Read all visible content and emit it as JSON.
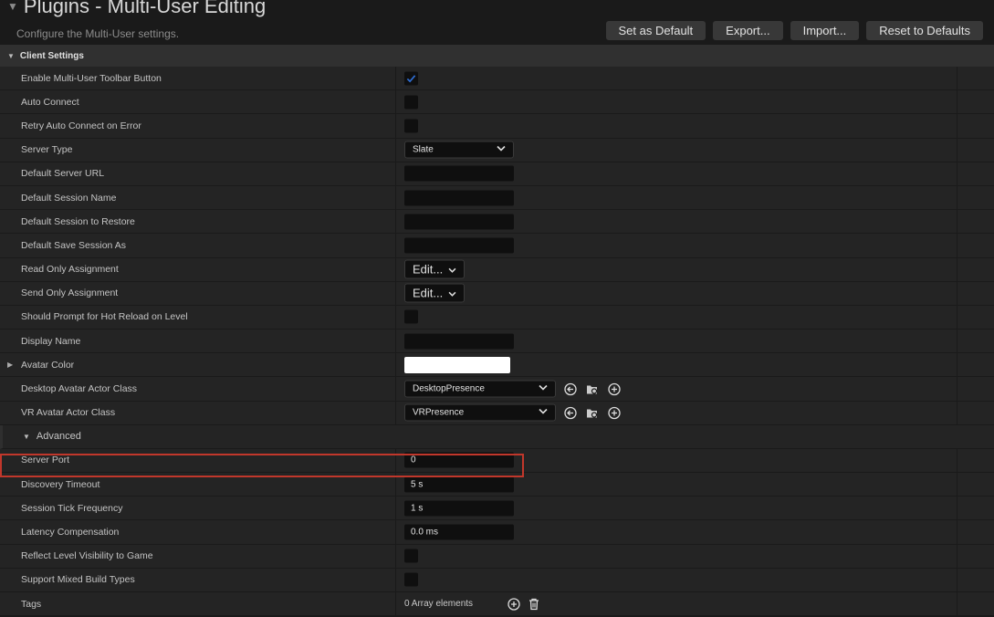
{
  "header": {
    "title": "Plugins - Multi-User Editing",
    "subtitle": "Configure the Multi-User settings.",
    "buttons": {
      "set_default": "Set as Default",
      "export": "Export...",
      "import": "Import...",
      "reset": "Reset to Defaults"
    }
  },
  "section": {
    "title": "Client Settings"
  },
  "rows": {
    "enable_toolbar": {
      "label": "Enable Multi-User Toolbar Button",
      "checked": true
    },
    "auto_connect": {
      "label": "Auto Connect",
      "checked": false
    },
    "retry_auto_connect": {
      "label": "Retry Auto Connect on Error",
      "checked": false
    },
    "server_type": {
      "label": "Server Type",
      "value": "Slate"
    },
    "default_server_url": {
      "label": "Default Server URL",
      "value": ""
    },
    "default_session_name": {
      "label": "Default Session Name",
      "value": ""
    },
    "default_session_restore": {
      "label": "Default Session to Restore",
      "value": ""
    },
    "default_save_session": {
      "label": "Default Save Session As",
      "value": ""
    },
    "read_only_assignment": {
      "label": "Read Only Assignment",
      "value": "Edit..."
    },
    "send_only_assignment": {
      "label": "Send Only Assignment",
      "value": "Edit..."
    },
    "prompt_hot_reload": {
      "label": "Should Prompt for Hot Reload on Level",
      "checked": false
    },
    "display_name": {
      "label": "Display Name",
      "value": ""
    },
    "avatar_color": {
      "label": "Avatar Color",
      "color": "#ffffff"
    },
    "desktop_avatar": {
      "label": "Desktop Avatar Actor Class",
      "value": "DesktopPresence"
    },
    "vr_avatar": {
      "label": "VR Avatar Actor Class",
      "value": "VRPresence"
    }
  },
  "advanced": {
    "title": "Advanced",
    "server_port": {
      "label": "Server Port",
      "value": "0"
    },
    "discovery_timeout": {
      "label": "Discovery Timeout",
      "value": "5 s"
    },
    "session_tick": {
      "label": "Session Tick Frequency",
      "value": "1 s"
    },
    "latency_comp": {
      "label": "Latency Compensation",
      "value": "0.0 ms"
    },
    "reflect_visibility": {
      "label": "Reflect Level Visibility to Game",
      "checked": false
    },
    "mixed_build": {
      "label": "Support Mixed Build Types",
      "checked": false
    },
    "tags": {
      "label": "Tags",
      "value": "0 Array elements"
    }
  },
  "colors": {
    "accent": "#2f6fd6",
    "highlight": "#c1372b"
  }
}
